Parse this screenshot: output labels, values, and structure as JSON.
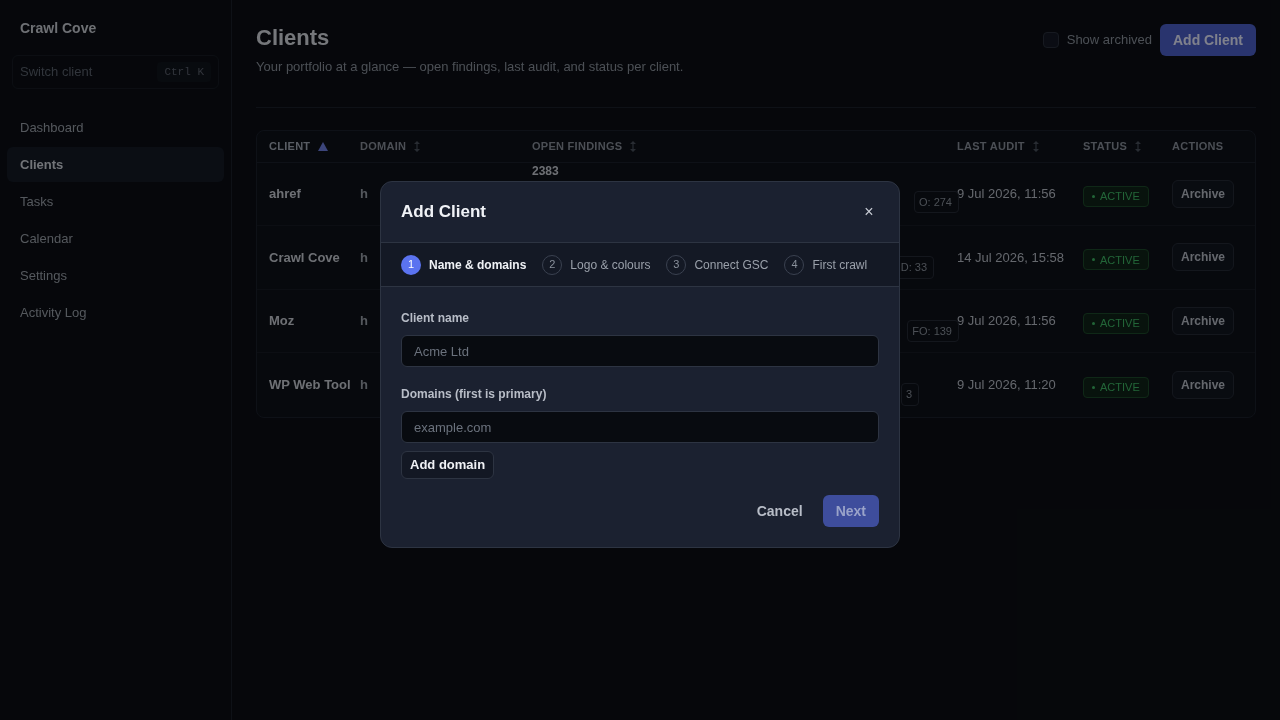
{
  "sidebar": {
    "brand": "Crawl Cove",
    "switcher": {
      "placeholder": "Switch client",
      "shortcut": "Ctrl K"
    },
    "items": [
      {
        "label": "Dashboard",
        "selected": false
      },
      {
        "label": "Clients",
        "selected": true
      },
      {
        "label": "Tasks",
        "selected": false
      },
      {
        "label": "Calendar",
        "selected": false
      },
      {
        "label": "Settings",
        "selected": false
      },
      {
        "label": "Activity Log",
        "selected": false
      }
    ]
  },
  "header": {
    "title": "Clients",
    "subtitle": "Your portfolio at a glance — open findings, last audit, and status per client.",
    "show_archived": {
      "label": "Show archived",
      "checked": false
    },
    "add_button": "Add Client"
  },
  "table": {
    "columns": [
      {
        "label": "CLIENT",
        "kind": "sorted"
      },
      {
        "label": "DOMAIN",
        "kind": "sortable"
      },
      {
        "label": "OPEN FINDINGS",
        "kind": "sortable"
      },
      {
        "label": "LAST AUDIT",
        "kind": "sortable"
      },
      {
        "label": "STATUS",
        "kind": "sortable"
      },
      {
        "label": "ACTIONS",
        "kind": "plain"
      }
    ],
    "rows": [
      {
        "client": "ahref",
        "domain": "h",
        "findings_count": "2383",
        "findings_tag": "O: 274",
        "last_audit": "9 Jul 2026, 11:56",
        "status": "ACTIVE",
        "action": "Archive"
      },
      {
        "client": "Crawl Cove",
        "domain": "h",
        "findings_tag": "D: 33",
        "last_audit": "14 Jul 2026, 15:58",
        "status": "ACTIVE",
        "action": "Archive"
      },
      {
        "client": "Moz",
        "domain": "h",
        "findings_tag": "FO: 139",
        "last_audit": "9 Jul 2026, 11:56",
        "status": "ACTIVE",
        "action": "Archive"
      },
      {
        "client": "WP Web Tool",
        "domain": "h",
        "findings_tag": "3",
        "last_audit": "9 Jul 2026, 11:20",
        "status": "ACTIVE",
        "action": "Archive"
      }
    ]
  },
  "modal": {
    "title": "Add Client",
    "close": "×",
    "steps": [
      {
        "number": "1",
        "label": "Name & domains",
        "selected": true
      },
      {
        "number": "2",
        "label": "Logo & colours",
        "selected": false
      },
      {
        "number": "3",
        "label": "Connect GSC",
        "selected": false
      },
      {
        "number": "4",
        "label": "First crawl",
        "selected": false
      }
    ],
    "fields": [
      {
        "label": "Client name",
        "placeholder": "Acme Ltd"
      },
      {
        "label": "Domains (first is primary)",
        "placeholder": "example.com"
      }
    ],
    "add_domain": "Add domain",
    "cancel": "Cancel",
    "next": {
      "label": "Next",
      "disabled": true
    }
  }
}
